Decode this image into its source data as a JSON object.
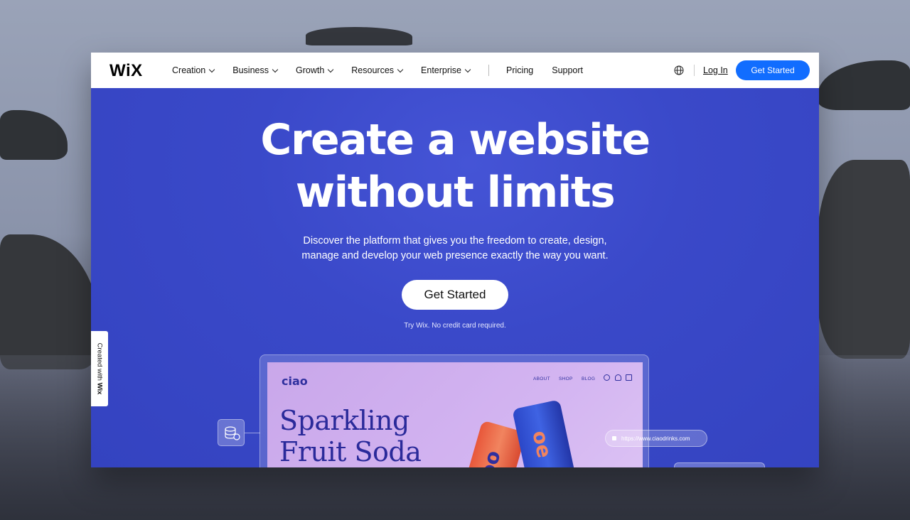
{
  "header": {
    "logo": "WiX",
    "nav": [
      {
        "label": "Creation",
        "dropdown": true
      },
      {
        "label": "Business",
        "dropdown": true
      },
      {
        "label": "Growth",
        "dropdown": true
      },
      {
        "label": "Resources",
        "dropdown": true
      },
      {
        "label": "Enterprise",
        "dropdown": true
      }
    ],
    "nav_plain": [
      {
        "label": "Pricing"
      },
      {
        "label": "Support"
      }
    ],
    "language_icon": "globe-icon",
    "login_label": "Log In",
    "cta_label": "Get Started"
  },
  "hero": {
    "title_line1": "Create a website",
    "title_line2": "without limits",
    "subtitle_line1": "Discover the platform that gives you the freedom to create, design,",
    "subtitle_line2": "manage and develop your web presence exactly the way you want.",
    "cta_label": "Get Started",
    "note": "Try Wix. No credit card required."
  },
  "badge": {
    "prefix": "Created with",
    "brand": "Wix"
  },
  "mockup": {
    "brand": "ciao",
    "nav": [
      "ABOUT",
      "SHOP",
      "BLOG"
    ],
    "headline_line1": "Sparkling",
    "headline_line2": "Fruit Soda",
    "can_label": "oe",
    "url": "https://www.ciaodrinks.com"
  },
  "colors": {
    "hero_bg": "#3a49c9",
    "cta_blue": "#116dff",
    "mockup_bg": "#d3b4f1"
  }
}
